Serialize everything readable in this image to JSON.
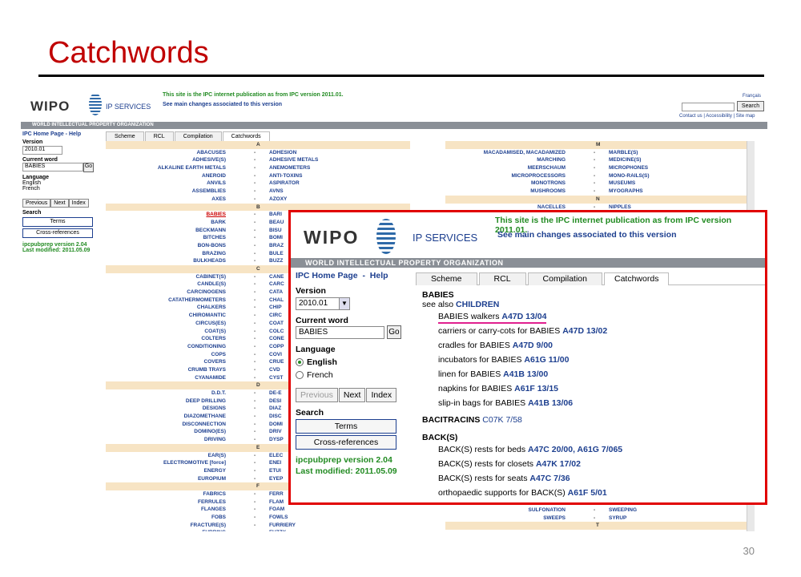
{
  "slide": {
    "title": "Catchwords",
    "page_number": "30"
  },
  "background": {
    "logo": "WIPO",
    "ip_services": "IP SERVICES",
    "notice1": "This site is the IPC internet publication as from IPC version 2011.01.",
    "notice2": "See main changes associated to this version",
    "francais": "Français",
    "search_button": "Search",
    "contact": "Contact us | Accessibility | Site map",
    "org_band": "WORLD INTELLECTUAL PROPERTY ORGANIZATION",
    "side": {
      "home": "IPC Home Page - Help",
      "version_label": "Version",
      "version": "2010.01",
      "current_word_label": "Current word",
      "current_word": "BABIES",
      "go": "Go",
      "language_label": "Language",
      "english": "English",
      "french": "French",
      "previous": "Previous",
      "next": "Next",
      "index": "Index",
      "search_label": "Search",
      "terms": "Terms",
      "cross_refs": "Cross-references",
      "version_info": "ipcpubprep version 2.04",
      "modified": "Last modified: 2011.05.09"
    },
    "tabs": [
      "Scheme",
      "RCL",
      "Compilation",
      "Catchwords"
    ],
    "left_column": [
      {
        "letter": "A"
      },
      {
        "l": "ABACUSES",
        "r": "ADHESION"
      },
      {
        "l": "ADHESIVE(S)",
        "r": "ADHESIVE METALS"
      },
      {
        "l": "ALKALINE EARTH METALS",
        "r": "ANEMOMETERS"
      },
      {
        "l": "ANEROID",
        "r": "ANTI-TOXINS"
      },
      {
        "l": "ANVILS",
        "r": "ASPIRATOR"
      },
      {
        "l": "ASSEMBLIES",
        "r": "AVNS"
      },
      {
        "l": "AXES",
        "r": "AZOXY"
      },
      {
        "letter": "B"
      },
      {
        "l": "BABIES",
        "r": "BARI",
        "hl": true
      },
      {
        "l": "BARK",
        "r": "BEAU"
      },
      {
        "l": "BECKMANN",
        "r": "BISU"
      },
      {
        "l": "BITCHES",
        "r": "BOMI"
      },
      {
        "l": "BON-BONS",
        "r": "BRAZ"
      },
      {
        "l": "BRAZING",
        "r": "BULE"
      },
      {
        "l": "BULKHEADS",
        "r": "BUZZ"
      },
      {
        "letter": "C"
      },
      {
        "l": "CABINET(S)",
        "r": "CANE"
      },
      {
        "l": "CANDLE(S)",
        "r": "CARC"
      },
      {
        "l": "CARCINOGENS",
        "r": "CATA"
      },
      {
        "l": "CATATHERMOMETERS",
        "r": "CHAL"
      },
      {
        "l": "CHALKERS",
        "r": "CHIP"
      },
      {
        "l": "CHIROMANTIC",
        "r": "CIRC"
      },
      {
        "l": "CIRCUS(ES)",
        "r": "COAT"
      },
      {
        "l": "COAT(S)",
        "r": "COLC"
      },
      {
        "l": "COLTERS",
        "r": "CONE"
      },
      {
        "l": "CONDITIONING",
        "r": "COPP"
      },
      {
        "l": "COPS",
        "r": "COVI"
      },
      {
        "l": "COVERS",
        "r": "CRUE"
      },
      {
        "l": "CRUMB TRAYS",
        "r": "CVD"
      },
      {
        "l": "CYANAMIDE",
        "r": "CYST"
      },
      {
        "letter": "D"
      },
      {
        "l": "D.D.T.",
        "r": "DE-E"
      },
      {
        "l": "DEEP DRILLING",
        "r": "DESI"
      },
      {
        "l": "DESIGNS",
        "r": "DIAZ"
      },
      {
        "l": "DIAZOMETHANE",
        "r": "DISC"
      },
      {
        "l": "DISCONNECTION",
        "r": "DOMI"
      },
      {
        "l": "DOMINO(ES)",
        "r": "DRIV"
      },
      {
        "l": "DRIVING",
        "r": "DYSP"
      },
      {
        "letter": "E"
      },
      {
        "l": "EAR(S)",
        "r": "ELEC"
      },
      {
        "l": "ELECTROMOTIVE [force]",
        "r": "ENEI"
      },
      {
        "l": "ENERGY",
        "r": "ETUI"
      },
      {
        "l": "EUROPIUM",
        "r": "EYEP"
      },
      {
        "letter": "F"
      },
      {
        "l": "FABRICS",
        "r": "FERR"
      },
      {
        "l": "FERRULES",
        "r": "FLAM"
      },
      {
        "l": "FLANGES",
        "r": "FOAM"
      },
      {
        "l": "FOBS",
        "r": "FOWLS"
      },
      {
        "l": "FRACTURE(S)",
        "r": "FURRIERY"
      },
      {
        "l": "FURRING",
        "r": "FUZZY"
      }
    ],
    "right_column": [
      {
        "letter": "M"
      },
      {
        "l": "MACADAMISED, MACADAMIZED",
        "r": "MARBLE(S)"
      },
      {
        "l": "MARCHING",
        "r": "MEDICINE(S)"
      },
      {
        "l": "MEERSCHAUM",
        "r": "MICROPHONES"
      },
      {
        "l": "MICROPROCESSORS",
        "r": "MONO-RAILS(S)"
      },
      {
        "l": "MONOTRONS",
        "r": "MUSEUMS"
      },
      {
        "l": "MUSHROOMS",
        "r": "MYOGRAPHS"
      },
      {
        "letter": "N"
      },
      {
        "l": "NACELLES",
        "r": "NIPPLES"
      }
    ],
    "right_bottom": [
      {
        "l": "SULFONATION",
        "r": "SWEEPING"
      },
      {
        "l": "SWEEPS",
        "r": "SYRUP"
      },
      {
        "letter": "T"
      }
    ]
  },
  "zoom": {
    "logo": "WIPO",
    "ip_services": "IP SERVICES",
    "notice1": "This site is the IPC internet publication as from IPC version 2011.01.",
    "notice2": "See main changes associated to this version",
    "org_band": "WORLD INTELLECTUAL PROPERTY ORGANIZATION",
    "home": "IPC Home Page",
    "dash": "-",
    "help": "Help",
    "version_label": "Version",
    "version": "2010.01",
    "current_word_label": "Current word",
    "current_word": "BABIES",
    "go": "Go",
    "language_label": "Language",
    "english": "English",
    "french": "French",
    "previous": "Previous",
    "next": "Next",
    "index": "Index",
    "search_label": "Search",
    "terms": "Terms",
    "cross_refs": "Cross-references",
    "version_info": "ipcpubprep version 2.04",
    "modified": "Last modified: 2011.05.09",
    "tabs": [
      "Scheme",
      "RCL",
      "Compilation",
      "Catchwords"
    ],
    "babies": "BABIES",
    "see_also": "see also",
    "children": "CHILDREN",
    "babies_entries": [
      {
        "text": "BABIES walkers",
        "code": "A47D 13/04"
      },
      {
        "text": "carriers or carry-cots for BABIES",
        "code": "A47D 13/02"
      },
      {
        "text": "cradles for BABIES",
        "code": "A47D 9/00"
      },
      {
        "text": "incubators for BABIES",
        "code": "A61G 11/00"
      },
      {
        "text": "linen for BABIES",
        "code": "A41B 13/00"
      },
      {
        "text": "napkins for BABIES",
        "code": "A61F 13/15"
      },
      {
        "text": "slip-in bags for BABIES",
        "code": "A41B 13/06"
      }
    ],
    "bacitracins": "BACITRACINS",
    "bacitracins_code": "C07K 7/58",
    "back": "BACK(S)",
    "back_entries": [
      {
        "text": "BACK(S) rests for beds",
        "code": "A47C 20/00, A61G 7/065"
      },
      {
        "text": "BACK(S) rests for closets",
        "code": "A47K 17/02"
      },
      {
        "text": "BACK(S) rests for seats",
        "code": "A47C 7/36"
      },
      {
        "text": "orthopaedic supports for BACK(S)",
        "code": "A61F 5/01"
      }
    ]
  }
}
